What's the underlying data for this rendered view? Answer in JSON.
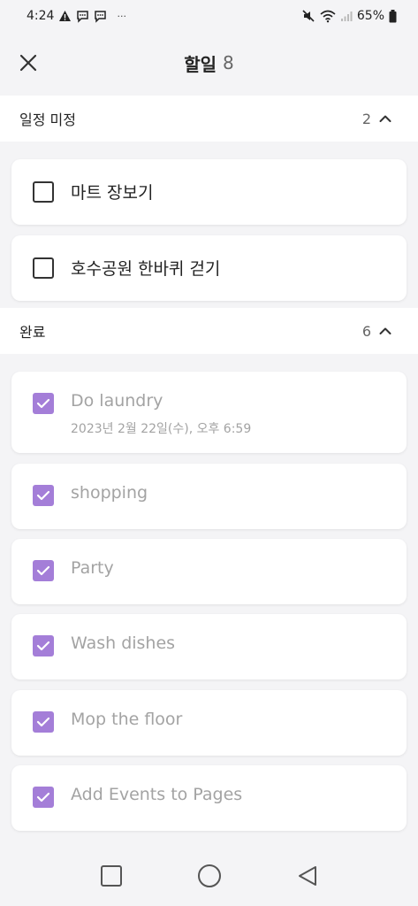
{
  "status_bar": {
    "time": "4:24",
    "extra": "···",
    "battery": "65%"
  },
  "header": {
    "title": "할일",
    "count": "8"
  },
  "sections": [
    {
      "title": "일정 미정",
      "count": "2",
      "tasks": [
        {
          "title": "마트 장보기",
          "completed": false
        },
        {
          "title": "호수공원 한바퀴 걷기",
          "completed": false
        }
      ]
    },
    {
      "title": "완료",
      "count": "6",
      "tasks": [
        {
          "title": "Do laundry",
          "date": "2023년 2월 22일(수), 오후 6:59",
          "completed": true
        },
        {
          "title": "shopping",
          "completed": true
        },
        {
          "title": "Party",
          "completed": true
        },
        {
          "title": "Wash dishes",
          "completed": true
        },
        {
          "title": "Mop the floor",
          "completed": true
        },
        {
          "title": "Add Events to Pages",
          "completed": true
        }
      ]
    }
  ],
  "colors": {
    "accent": "#a47ed8",
    "background": "#f4f4f6",
    "completed_text": "#a3a3a3"
  },
  "icons": {
    "close": "close-icon",
    "collapse": "chevron-up-icon",
    "check": "check-icon",
    "nav_recent": "square-icon",
    "nav_home": "circle-icon",
    "nav_back": "triangle-back-icon"
  }
}
